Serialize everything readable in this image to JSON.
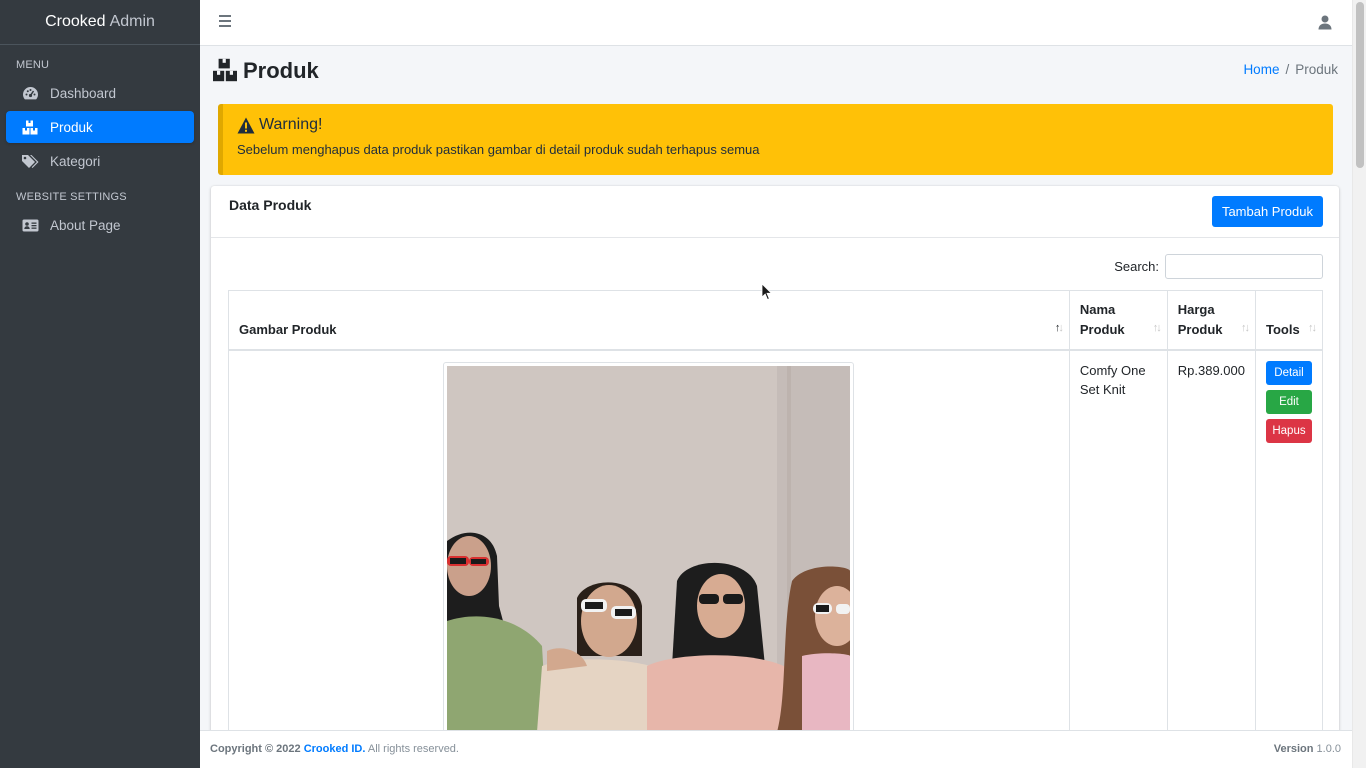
{
  "brand": {
    "name": "Crooked",
    "suffix": "Admin"
  },
  "sidebar": {
    "menu_header": "MENU",
    "items": [
      {
        "label": "Dashboard",
        "icon": "tachometer-icon"
      },
      {
        "label": "Produk",
        "icon": "boxes-icon",
        "active": true
      },
      {
        "label": "Kategori",
        "icon": "tags-icon"
      }
    ],
    "settings_header": "WEBSITE SETTINGS",
    "settings_items": [
      {
        "label": "About Page",
        "icon": "id-card-icon"
      }
    ]
  },
  "topbar": {
    "menu_icon": "hamburger-icon",
    "user_icon": "user-icon"
  },
  "page": {
    "title": "Produk",
    "breadcrumb": {
      "home": "Home",
      "current": "Produk"
    }
  },
  "alert": {
    "title": "Warning!",
    "text": "Sebelum menghapus data produk pastikan gambar di detail produk sudah terhapus semua"
  },
  "card": {
    "title": "Data Produk",
    "add_button": "Tambah Produk",
    "search_label": "Search:",
    "search_value": "",
    "columns": [
      "Gambar Produk",
      "Nama Produk",
      "Harga Produk",
      "Tools"
    ],
    "rows": [
      {
        "name": "Comfy One Set Knit",
        "price": "Rp.389.000",
        "tools": [
          "Detail",
          "Edit",
          "Hapus"
        ]
      }
    ]
  },
  "footer": {
    "copyright": "Copyright © 2022",
    "company": "Crooked ID.",
    "rights": "All rights reserved.",
    "version_label": "Version",
    "version": "1.0.0"
  },
  "colors": {
    "sidebar_bg": "#343a40",
    "primary": "#007bff",
    "success": "#28a745",
    "danger": "#dc3545",
    "warning": "#ffc107"
  }
}
